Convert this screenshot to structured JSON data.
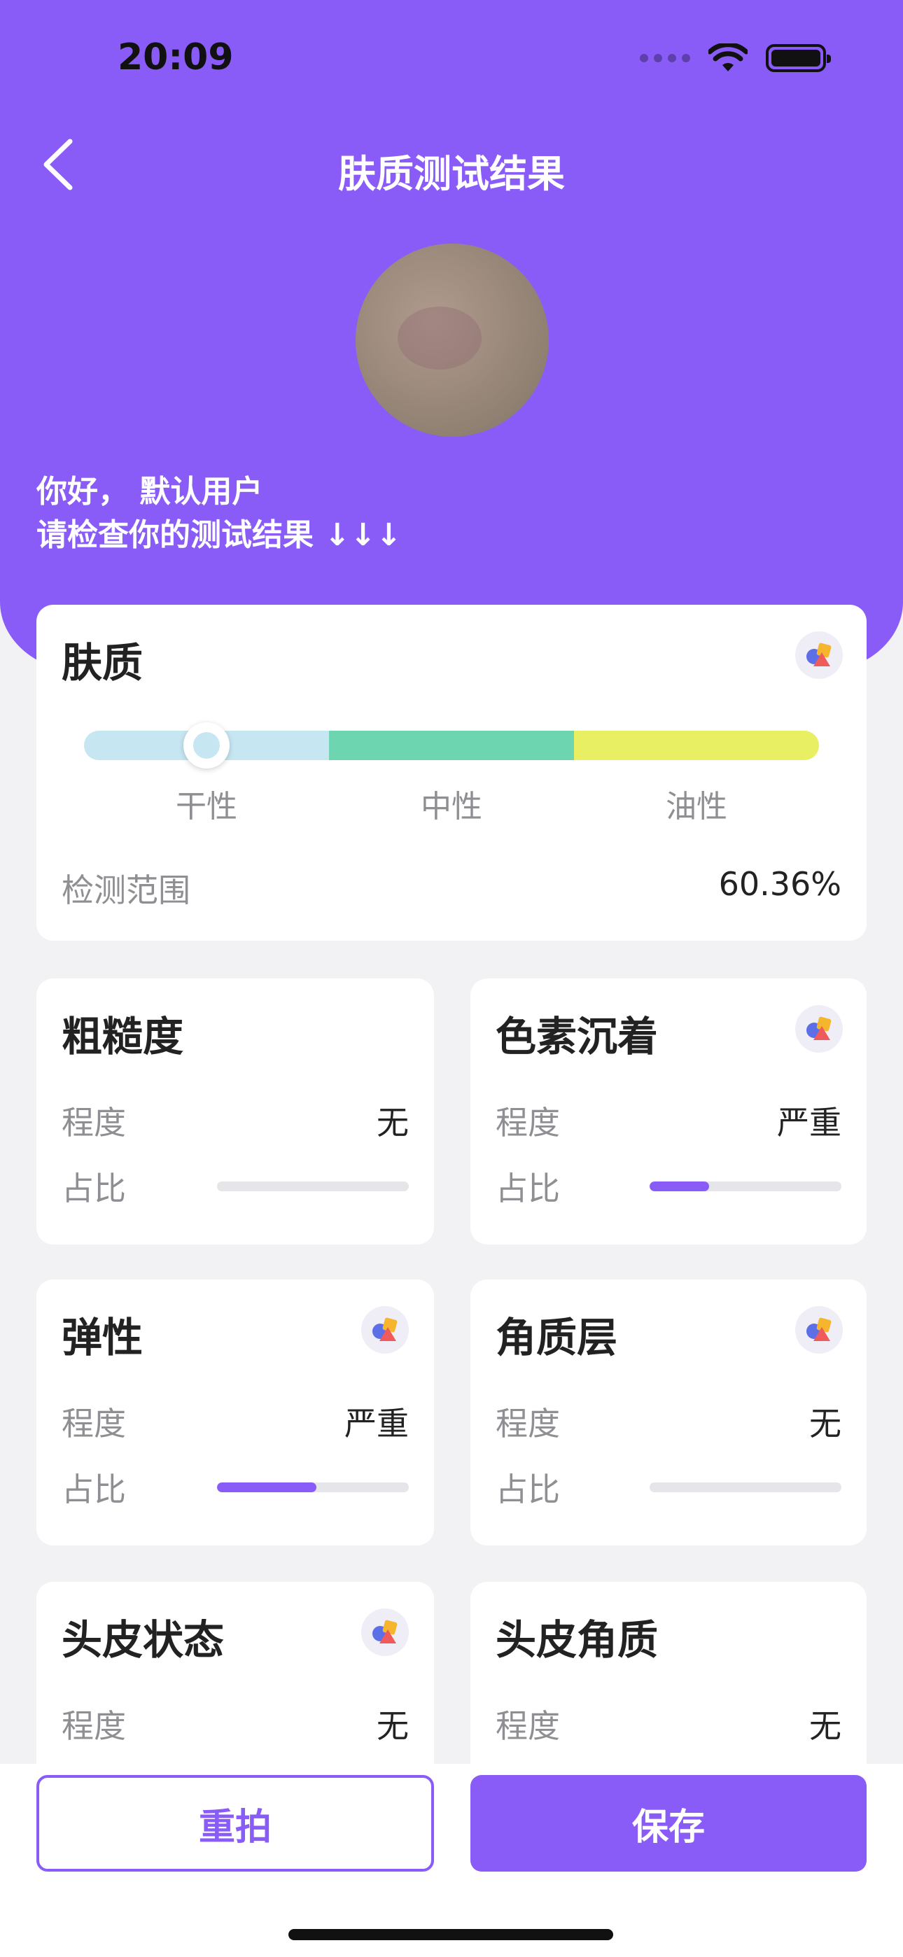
{
  "status_bar": {
    "time": "20:09"
  },
  "header": {
    "title": "肤质测试结果",
    "greeting_line1": "你好， 默认用户",
    "greeting_line2": "请检查你的测试结果 ↓↓↓"
  },
  "skin_type": {
    "title": "肤质",
    "labels": [
      "干性",
      "中性",
      "油性"
    ],
    "colors": [
      "#c6e6f2",
      "#6dd6b0",
      "#e8ef62"
    ],
    "detect_label": "检测范围",
    "detect_value": "60.36%",
    "position_percent": 16.7
  },
  "metrics": [
    {
      "title": "粗糙度",
      "degree_label": "程度",
      "degree": "无",
      "ratio_label": "占比",
      "ratio": 0,
      "ai": false
    },
    {
      "title": "色素沉着",
      "degree_label": "程度",
      "degree": "严重",
      "ratio_label": "占比",
      "ratio": 0.31,
      "ai": true
    },
    {
      "title": "弹性",
      "degree_label": "程度",
      "degree": "严重",
      "ratio_label": "占比",
      "ratio": 0.52,
      "ai": true
    },
    {
      "title": "角质层",
      "degree_label": "程度",
      "degree": "无",
      "ratio_label": "占比",
      "ratio": 0,
      "ai": true
    },
    {
      "title": "头皮状态",
      "degree_label": "程度",
      "degree": "无",
      "ai": true
    },
    {
      "title": "头皮角质",
      "degree_label": "程度",
      "degree": "无",
      "ai": false
    }
  ],
  "actions": {
    "retake": "重拍",
    "save": "保存"
  },
  "theme": {
    "accent": "#8a5cf7"
  }
}
